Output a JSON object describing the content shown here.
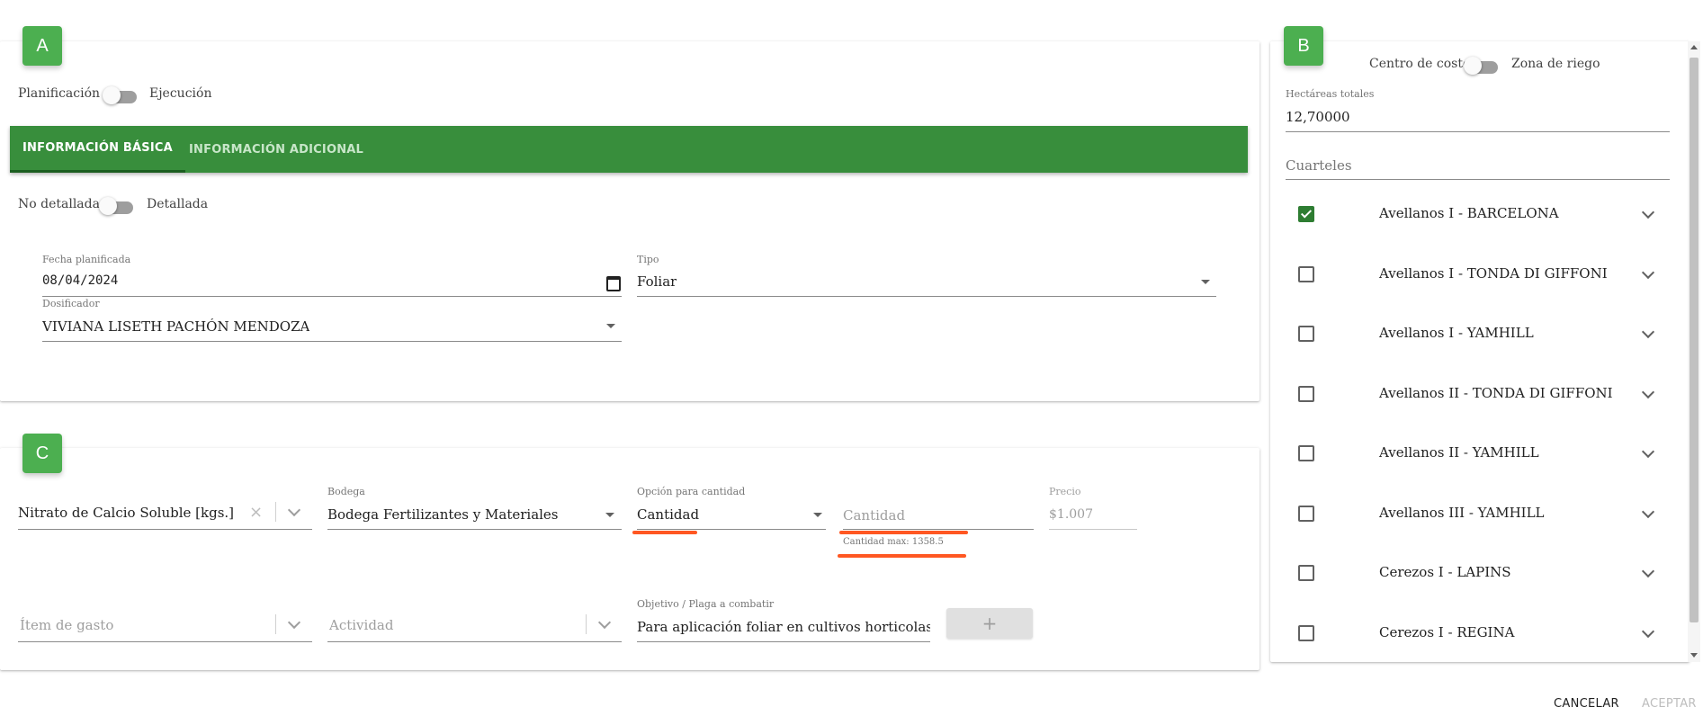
{
  "badges": {
    "a": "A",
    "b": "B",
    "c": "C"
  },
  "section_a": {
    "mode_toggle": {
      "left_label": "Planificación",
      "right_label": "Ejecución"
    },
    "tabs": [
      {
        "label": "INFORMACIÓN BÁSICA",
        "active": true
      },
      {
        "label": "INFORMACIÓN ADICIONAL",
        "active": false
      }
    ],
    "detail_toggle": {
      "left_label": "No detallada",
      "right_label": "Detallada"
    },
    "fecha": {
      "label": "Fecha planificada",
      "value": "08/04/2024"
    },
    "tipo": {
      "label": "Tipo",
      "value": "Foliar"
    },
    "dosificador": {
      "label": "Dosificador",
      "value": "VIVIANA LISETH PACHÓN MENDOZA"
    }
  },
  "section_b": {
    "cost_toggle": {
      "left_label": "Centro de costo",
      "right_label": "Zona de riego"
    },
    "hectareas": {
      "label": "Hectáreas totales",
      "value": "12,70000"
    },
    "cuarteles": {
      "label": "Cuarteles"
    },
    "rows": [
      {
        "label": "Avellanos I - BARCELONA",
        "checked": true
      },
      {
        "label": "Avellanos I - TONDA DI GIFFONI",
        "checked": false
      },
      {
        "label": "Avellanos I - YAMHILL",
        "checked": false
      },
      {
        "label": "Avellanos II - TONDA DI GIFFONI",
        "checked": false
      },
      {
        "label": "Avellanos II - YAMHILL",
        "checked": false
      },
      {
        "label": "Avellanos III - YAMHILL",
        "checked": false
      },
      {
        "label": "Cerezos I - LAPINS",
        "checked": false
      },
      {
        "label": "Cerezos I - REGINA",
        "checked": false
      }
    ]
  },
  "section_c": {
    "producto": {
      "value": "Nitrato de Calcio Soluble [kgs.]"
    },
    "bodega": {
      "label": "Bodega",
      "value": "Bodega Fertilizantes y Materiales"
    },
    "opcion": {
      "label": "Opción para cantidad",
      "value": "Cantidad"
    },
    "cantidad": {
      "placeholder": "Cantidad",
      "hint": "Cantidad max: 1358.5"
    },
    "precio": {
      "label": "Precio",
      "value": "$1.007"
    },
    "item_gasto": {
      "placeholder": "Ítem de gasto"
    },
    "actividad": {
      "placeholder": "Actividad"
    },
    "objetivo": {
      "label": "Objetivo / Plaga a combatir",
      "value": "Para aplicación foliar en cultivos horticolas y a"
    },
    "add_symbol": "+"
  },
  "footer": {
    "cancel": "CANCELAR",
    "accept": "ACEPTAR"
  },
  "colors": {
    "accent_green": "#388e3c",
    "badge_green": "#4caf50",
    "highlight": "#ff5722"
  }
}
